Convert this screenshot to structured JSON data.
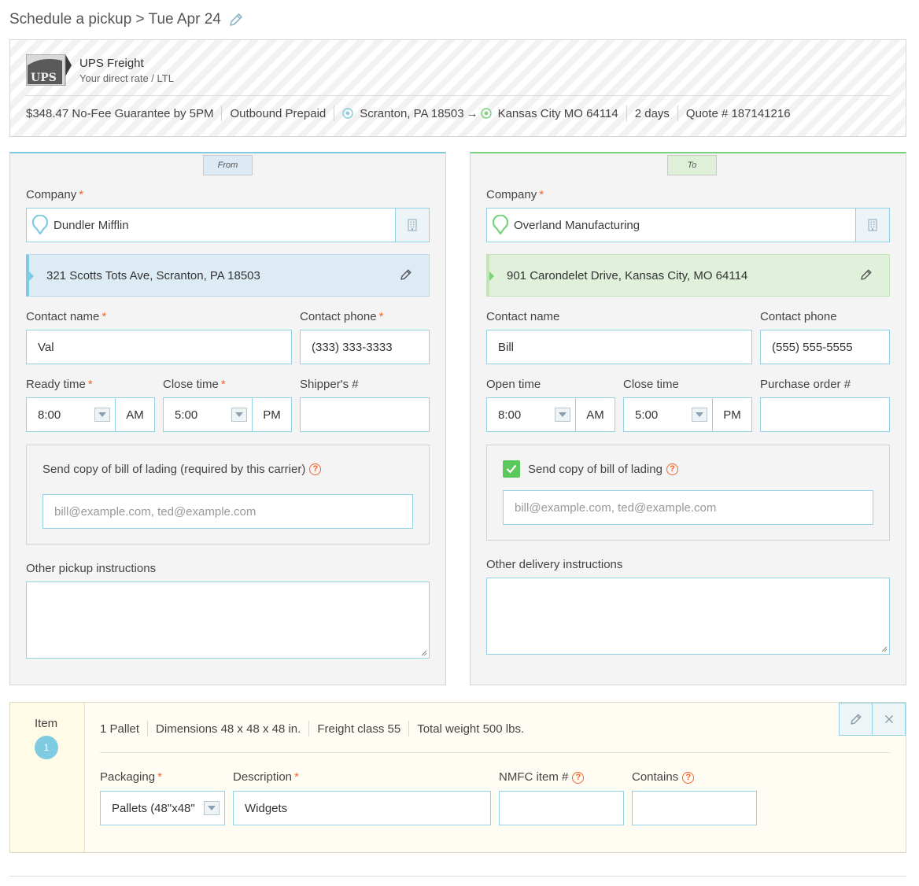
{
  "header": {
    "title": "Schedule a pickup > Tue Apr 24"
  },
  "carrier": {
    "logo_text": "UPS",
    "name": "UPS Freight",
    "rate_type": "Your direct rate / LTL",
    "price_guarantee": "$348.47 No-Fee Guarantee by 5PM",
    "payment": "Outbound Prepaid",
    "origin": "Scranton,  PA 18503",
    "destination": "Kansas City  MO 64114",
    "transit": "2 days",
    "quote": "Quote # 187141216",
    "colors": {
      "origin": "#7fcbe2",
      "destination": "#79d179"
    }
  },
  "from": {
    "tab": "From",
    "company_label": "Company",
    "company_value": "Dundler Mifflin",
    "address": "321 Scotts Tots Ave, Scranton, PA 18503",
    "contact_name_label": "Contact name",
    "contact_name_value": "Val",
    "contact_phone_label": "Contact phone",
    "contact_phone_value": "(333) 333-3333",
    "time1_label": "Ready time",
    "time1_value": "8:00",
    "time1_ampm": "AM",
    "time2_label": "Close time",
    "time2_value": "5:00",
    "time2_ampm": "PM",
    "ref_label": "Shipper's #",
    "ref_value": "",
    "bol_text": "Send copy of bill of lading (required by this carrier)",
    "bol_placeholder": "bill@example.com, ted@example.com",
    "instructions_label": "Other pickup instructions",
    "instructions_value": ""
  },
  "to": {
    "tab": "To",
    "company_label": "Company",
    "company_value": "Overland Manufacturing",
    "address": "901 Carondelet Drive, Kansas City, MO 64114",
    "contact_name_label": "Contact name",
    "contact_name_value": "Bill",
    "contact_phone_label": "Contact phone",
    "contact_phone_value": "(555) 555-5555",
    "time1_label": "Open time",
    "time1_value": "8:00",
    "time1_ampm": "AM",
    "time2_label": "Close time",
    "time2_value": "5:00",
    "time2_ampm": "PM",
    "ref_label": "Purchase order #",
    "ref_value": "",
    "bol_text": "Send copy of bill of lading",
    "bol_checked": true,
    "bol_placeholder": "bill@example.com, ted@example.com",
    "instructions_label": "Other delivery instructions",
    "instructions_value": ""
  },
  "item": {
    "label": "Item",
    "number": "1",
    "quantity": "1  Pallet",
    "dimensions": "Dimensions 48 x 48 x 48 in.",
    "freight_class": "Freight class 55",
    "total_weight": "Total weight 500 lbs.",
    "packaging_label": "Packaging",
    "packaging_value": "Pallets (48\"x48\"",
    "description_label": "Description",
    "description_value": "Widgets",
    "nmfc_label": "NMFC item #",
    "nmfc_value": "",
    "contains_label": "Contains",
    "contains_value": ""
  }
}
